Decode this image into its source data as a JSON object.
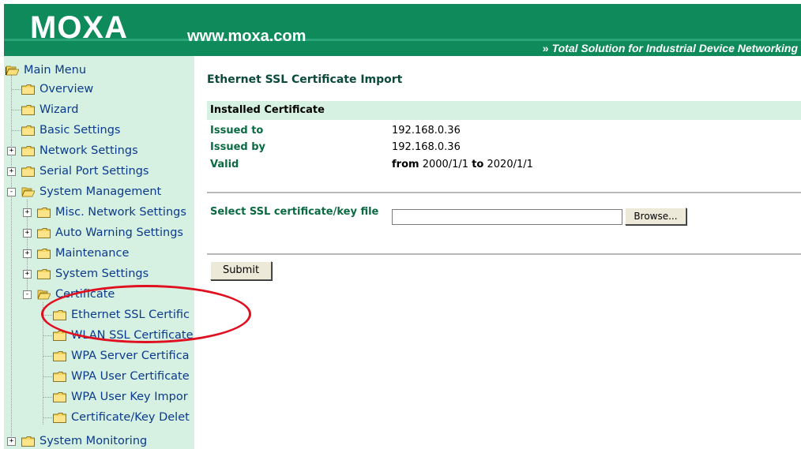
{
  "header": {
    "logo": "MOXA",
    "url": "www.moxa.com",
    "tagline_chevron": "»",
    "tagline": "Total Solution for Industrial Device Networking",
    "background": "#0f8a5b"
  },
  "sidebar": {
    "background": "#d6f1e2",
    "items": [
      {
        "label": "Main Menu",
        "icon": "open-folder-icon",
        "expander": ""
      },
      {
        "label": "Overview",
        "icon": "folder-icon",
        "expander": ""
      },
      {
        "label": "Wizard",
        "icon": "folder-icon",
        "expander": ""
      },
      {
        "label": "Basic Settings",
        "icon": "folder-icon",
        "expander": ""
      },
      {
        "label": "Network Settings",
        "icon": "folder-icon",
        "expander": "+"
      },
      {
        "label": "Serial Port Settings",
        "icon": "folder-icon",
        "expander": "+"
      },
      {
        "label": "System Management",
        "icon": "open-folder-icon",
        "expander": "-"
      },
      {
        "label": "Misc. Network Settings",
        "icon": "folder-icon",
        "expander": "+"
      },
      {
        "label": "Auto Warning Settings",
        "icon": "folder-icon",
        "expander": "+"
      },
      {
        "label": "Maintenance",
        "icon": "folder-icon",
        "expander": "+"
      },
      {
        "label": "System Settings",
        "icon": "folder-icon",
        "expander": "+"
      },
      {
        "label": "Certificate",
        "icon": "open-folder-icon",
        "expander": "-"
      },
      {
        "label": "Ethernet SSL Certific",
        "icon": "folder-icon",
        "expander": ""
      },
      {
        "label": "WLAN SSL Certificate",
        "icon": "folder-icon",
        "expander": ""
      },
      {
        "label": "WPA Server Certifica",
        "icon": "folder-icon",
        "expander": ""
      },
      {
        "label": "WPA User Certificate",
        "icon": "folder-icon",
        "expander": ""
      },
      {
        "label": "WPA User Key Impor",
        "icon": "folder-icon",
        "expander": ""
      },
      {
        "label": "Certificate/Key Delet",
        "icon": "folder-icon",
        "expander": ""
      },
      {
        "label": "System Monitoring",
        "icon": "folder-icon",
        "expander": "+"
      }
    ]
  },
  "main": {
    "title": "Ethernet SSL Certificate Import",
    "installed": {
      "section_title": "Installed Certificate",
      "issued_to_label": "Issued to",
      "issued_to_value": "192.168.0.36",
      "issued_by_label": "Issued by",
      "issued_by_value": "192.168.0.36",
      "valid_label": "Valid",
      "valid_from_word": "from",
      "valid_from": "2000/1/1",
      "valid_to_word": "to",
      "valid_to": "2020/1/1"
    },
    "file_select": {
      "label": "Select SSL certificate/key file",
      "value": "",
      "browse_label": "Browse..."
    },
    "submit_label": "Submit"
  },
  "colors": {
    "accent_green": "#0f8a5b",
    "label_green": "#0a6b42",
    "tree_text": "#0b3a8c",
    "annotation_red": "#e01020"
  }
}
